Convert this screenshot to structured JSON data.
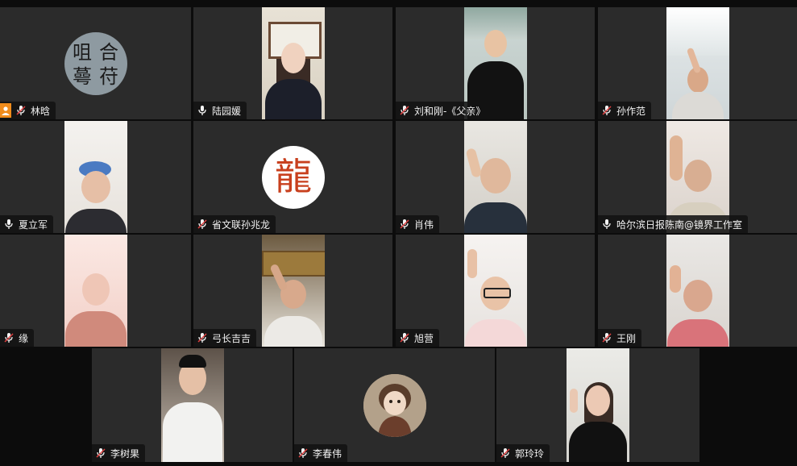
{
  "participants": [
    {
      "name": "林晗",
      "mic": "muted",
      "host": true,
      "media": "avatar-calligraphy"
    },
    {
      "name": "陆园媛",
      "mic": "on",
      "media": "video"
    },
    {
      "name": "刘和刚-《父亲》",
      "mic": "muted",
      "media": "video"
    },
    {
      "name": "孙作范",
      "mic": "muted",
      "media": "video"
    },
    {
      "name": "夏立军",
      "mic": "on",
      "media": "video"
    },
    {
      "name": "省文联孙兆龙",
      "mic": "muted",
      "media": "avatar-dragon"
    },
    {
      "name": "肖伟",
      "mic": "muted",
      "media": "video"
    },
    {
      "name": "哈尔滨日报陈南@镜界工作室",
      "mic": "on",
      "media": "video"
    },
    {
      "name": "缘",
      "mic": "muted",
      "media": "video"
    },
    {
      "name": "弓长吉吉",
      "mic": "muted",
      "media": "video"
    },
    {
      "name": "旭营",
      "mic": "muted",
      "media": "video"
    },
    {
      "name": "王刚",
      "mic": "muted",
      "media": "video"
    },
    {
      "name": "李树果",
      "mic": "muted",
      "media": "video"
    },
    {
      "name": "李春伟",
      "mic": "muted",
      "media": "avatar-painting"
    },
    {
      "name": "郭玲玲",
      "mic": "muted",
      "media": "video"
    }
  ],
  "avatar_texts": {
    "calligraphy": [
      "合",
      "苻",
      "咀",
      "蕚"
    ],
    "dragon": "龍"
  },
  "colors": {
    "tile_bg": "#2b2b2b",
    "gap_bg": "#0c0c0c",
    "muted_icon": "#f3f3f3",
    "host_badge": "#f08c1c"
  }
}
